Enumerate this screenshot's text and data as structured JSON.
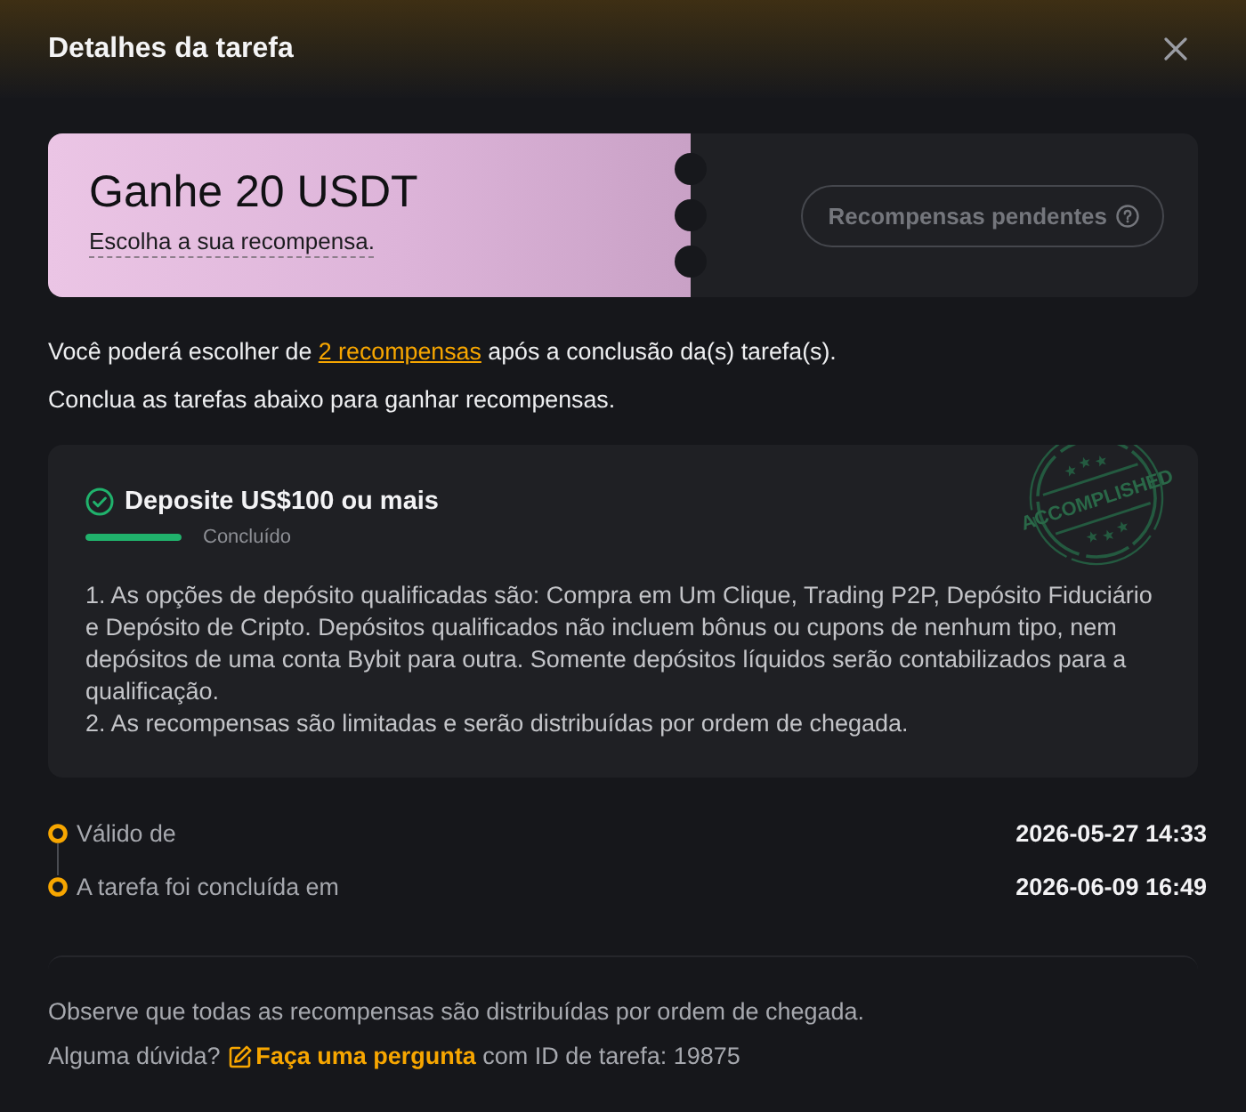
{
  "header": {
    "title": "Detalhes da tarefa"
  },
  "reward": {
    "title": "Ganhe 20 USDT",
    "subtitle": "Escolha a sua recompensa.",
    "button": "Recompensas pendentes"
  },
  "intro": {
    "before": "Você poderá escolher de ",
    "link": "2 recompensas",
    "after": " após a conclusão da(s) tarefa(s)."
  },
  "instruction": "Conclua as tarefas abaixo para ganhar recompensas.",
  "task": {
    "title": "Deposite US$100 ou mais",
    "completed": true,
    "level": 1,
    "status": "Concluído",
    "stamp": "ACCOMPLISHED",
    "rules": [
      "1. As opções de depósito qualificadas são: Compra em Um Clique, Trading P2P, Depósito Fiduciário e Depósito de Cripto. Depósitos qualificados não incluem bônus ou cupons de nenhum tipo, nem depósitos de uma conta Bybit para outra. Somente depósitos líquidos serão contabilizados para a qualificação.",
      "2. As recompensas são limitadas e serão distribuídas por ordem de chegada."
    ]
  },
  "timeline": [
    {
      "label": "Válido de",
      "value": "2026-05-27 14:33"
    },
    {
      "label": "A tarefa foi concluída em",
      "value": "2026-06-09 16:49"
    }
  ],
  "footer": {
    "note": "Observe que todas as recompensas são distribuídas por ordem de chegada.",
    "question": {
      "before": "Alguma dúvida? ",
      "link": "Faça uma pergunta",
      "after": " com ID de tarefa: 19875"
    }
  }
}
